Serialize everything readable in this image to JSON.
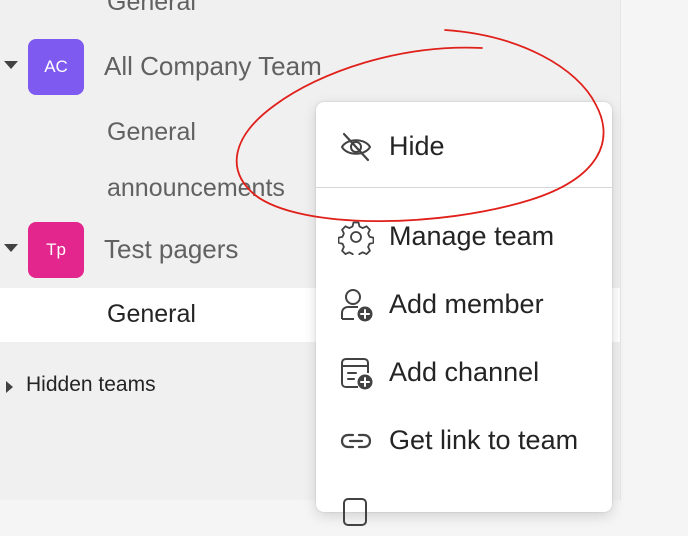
{
  "sidebar": {
    "top_channel": "General",
    "teams": [
      {
        "avatar": "AC",
        "avatar_color": "#7f5af0",
        "name": "All Company Team",
        "channels": [
          "General",
          "announcements"
        ]
      },
      {
        "avatar": "Tp",
        "avatar_color": "#e3268e",
        "name": "Test pagers",
        "channels": [
          "General"
        ]
      }
    ],
    "hidden_teams_label": "Hidden teams"
  },
  "context_menu": {
    "items": [
      {
        "label": "Hide",
        "icon": "eye-off-icon"
      },
      {
        "label": "Manage team",
        "icon": "gear-icon"
      },
      {
        "label": "Add member",
        "icon": "add-person-icon"
      },
      {
        "label": "Add channel",
        "icon": "add-channel-icon"
      },
      {
        "label": "Get link to team",
        "icon": "link-icon"
      }
    ]
  },
  "annotation": {
    "color": "#e0201b"
  }
}
